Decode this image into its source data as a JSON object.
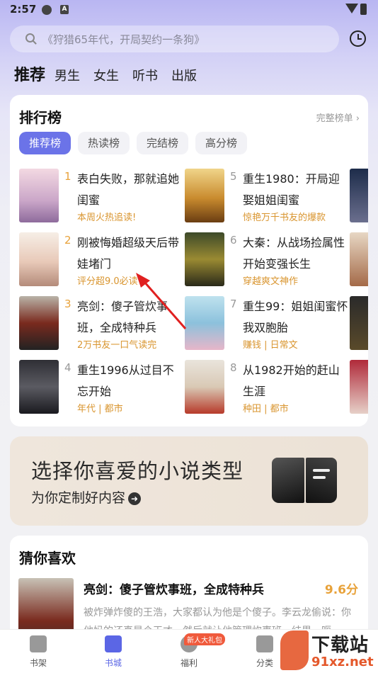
{
  "status_bar": {
    "time": "2:57",
    "app_badge": "A"
  },
  "search": {
    "placeholder": "《狩猎65年代，开局契约一条狗》"
  },
  "channel_tabs": [
    "推荐",
    "男生",
    "女生",
    "听书",
    "出版"
  ],
  "ranking": {
    "title": "排行榜",
    "more_label": "完整榜单 ›",
    "tabs": [
      "推荐榜",
      "热读榜",
      "完结榜",
      "高分榜"
    ],
    "items": [
      {
        "rank": "1",
        "title": "表白失败，那就追她闺蜜",
        "tag": "本周火热追读!"
      },
      {
        "rank": "2",
        "title": "刚被悔婚超级天后带娃堵门",
        "tag": "评分超9.0必读"
      },
      {
        "rank": "3",
        "title": "亮剑：傻子管炊事班，全成特种兵",
        "tag": "2万书友一口气读完"
      },
      {
        "rank": "4",
        "title": "重生1996从过目不忘开始",
        "tag": "年代 | 都市"
      },
      {
        "rank": "5",
        "title": "重生1980：开局迎娶姐姐闺蜜",
        "tag": "惊艳万千书友的爆款"
      },
      {
        "rank": "6",
        "title": "大秦：从战场捡属性开始变强长生",
        "tag": "穿越爽文神作"
      },
      {
        "rank": "7",
        "title": "重生99：姐姐闺蜜怀我双胞胎",
        "tag": "赚钱 | 日常文"
      },
      {
        "rank": "8",
        "title": "从1982开始的赶山生涯",
        "tag": "种田 | 都市"
      }
    ]
  },
  "banner": {
    "title": "选择你喜爱的小说类型",
    "subtitle": "为你定制好内容"
  },
  "recommend": {
    "title": "猜你喜欢",
    "book": {
      "title": "亮剑：傻子管炊事班，全成特种兵",
      "score": "9.6分",
      "desc": "被炸弹炸傻的王浩，大家都认为他是个傻子。李云龙偷说：你他妈的还真是个天才，然后就让他管理炊事班，结果…呃…"
    }
  },
  "bottom_nav": {
    "items": [
      "书架",
      "书城",
      "福利",
      "分类"
    ],
    "gift_badge": "新人大礼包"
  },
  "watermark": {
    "text": "下载站",
    "url": "91xz.net"
  },
  "colors": {
    "accent": "#6b73e8",
    "tag": "#d9952f",
    "score": "#e8a23a"
  }
}
